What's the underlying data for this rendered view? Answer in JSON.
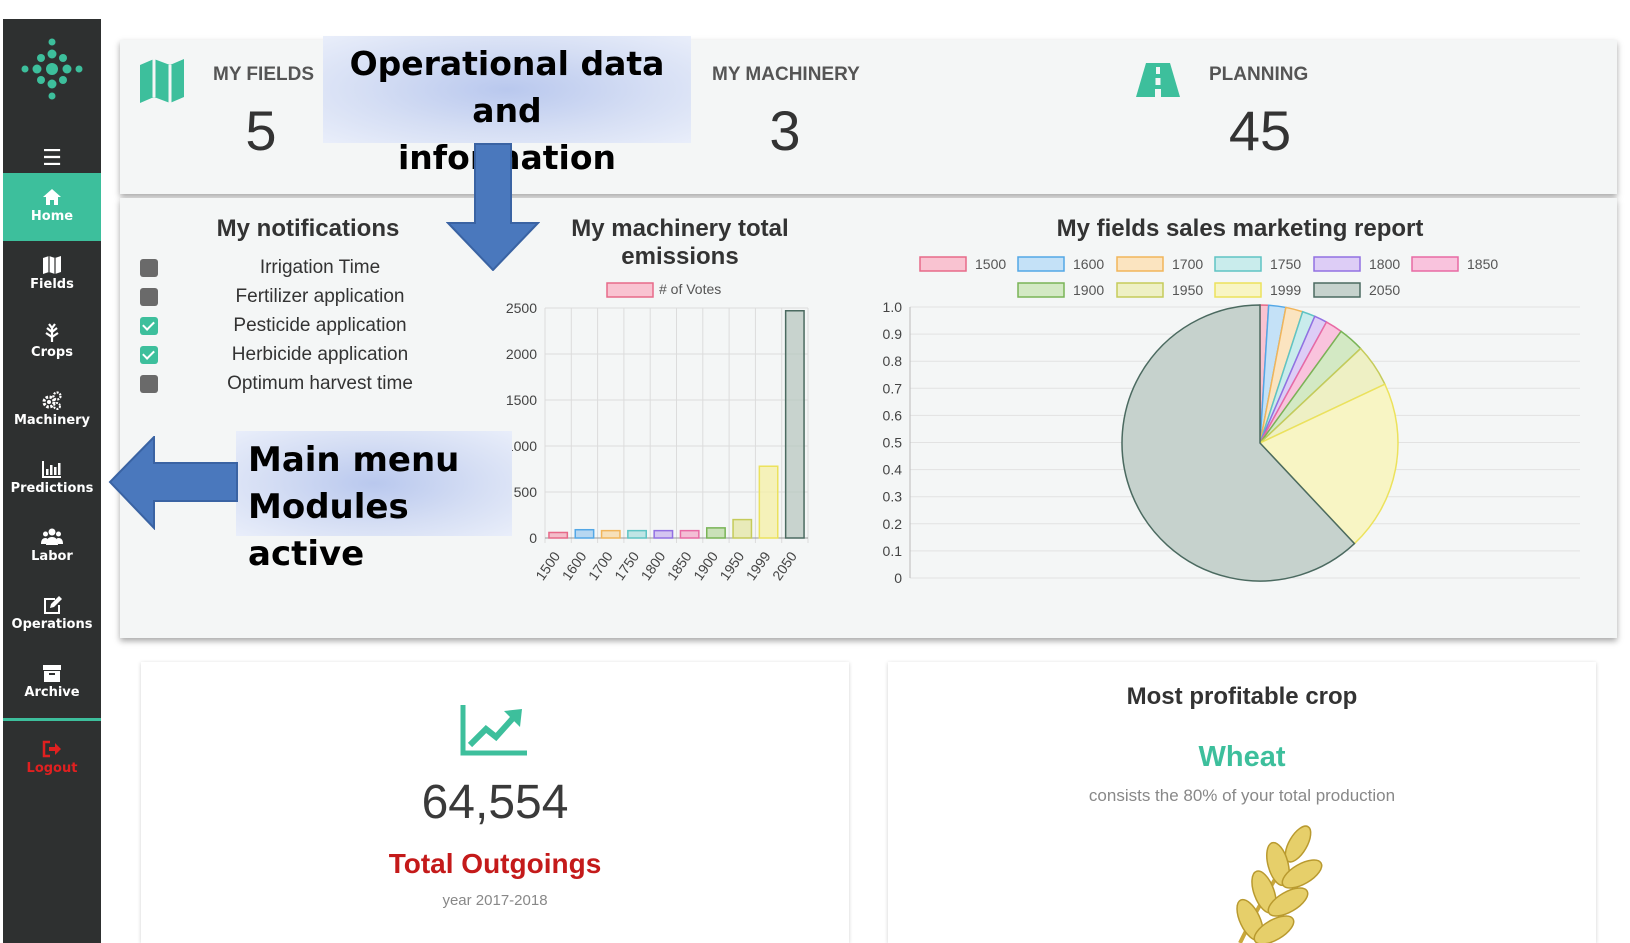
{
  "sidebar": {
    "menu_icon": "hamburger-icon",
    "items": [
      {
        "label": "Home",
        "icon": "home-icon",
        "active": true
      },
      {
        "label": "Fields",
        "icon": "map-icon"
      },
      {
        "label": "Crops",
        "icon": "plant-icon"
      },
      {
        "label": "Machinery",
        "icon": "cogs-icon"
      },
      {
        "label": "Predictions",
        "icon": "bar-chart-icon"
      },
      {
        "label": "Labor",
        "icon": "users-icon"
      },
      {
        "label": "Operations",
        "icon": "edit-icon"
      },
      {
        "label": "Archive",
        "icon": "archive-icon"
      }
    ],
    "logout": {
      "label": "Logout",
      "icon": "sign-out-icon"
    }
  },
  "stats": {
    "fields": {
      "label": "MY FIELDS",
      "value": "5",
      "icon": "map-icon"
    },
    "machinery": {
      "label": "MY MACHINERY",
      "value": "3"
    },
    "planning": {
      "label": "PLANNING",
      "value": "45",
      "icon": "road-icon"
    }
  },
  "callouts": {
    "top_line1": "Operational data and",
    "top_line2": "information",
    "left_line1": "Main menu",
    "left_line2": "Modules active"
  },
  "notifications": {
    "title": "My notifications",
    "items": [
      {
        "label": "Irrigation Time",
        "checked": false
      },
      {
        "label": "Fertilizer application",
        "checked": false
      },
      {
        "label": "Pesticide application",
        "checked": true
      },
      {
        "label": "Herbicide application",
        "checked": true
      },
      {
        "label": "Optimum harvest time",
        "checked": false
      }
    ]
  },
  "chart_data": [
    {
      "type": "bar",
      "title": "My machinery total emissions",
      "legend": [
        "# of Votes"
      ],
      "categories": [
        "1500",
        "1600",
        "1700",
        "1750",
        "1800",
        "1850",
        "1900",
        "1950",
        "1999",
        "2050"
      ],
      "values": [
        60,
        90,
        80,
        80,
        80,
        80,
        110,
        200,
        780,
        2470
      ],
      "ylim": [
        0,
        2500
      ],
      "yticks": [
        "0",
        "500",
        "1000",
        "1500",
        "2000",
        "2500"
      ],
      "grid": true,
      "legend_position": "top",
      "colors": [
        "#f2a6b8",
        "#9ccbef",
        "#f7d7a0",
        "#a8dede",
        "#c6b0ef",
        "#f2a6c8",
        "#b8d9a0",
        "#e3e6a0",
        "#f5f0a0",
        "#b5c4be"
      ],
      "borders": [
        "#e76a89",
        "#53a7e6",
        "#f1b55a",
        "#5fc4c4",
        "#9270e2",
        "#e86aa4",
        "#79b456",
        "#c5cb5a",
        "#ece25c",
        "#4b6a60"
      ]
    },
    {
      "type": "pie",
      "title": "My fields sales marketing report",
      "categories": [
        "1500",
        "1600",
        "1700",
        "1750",
        "1800",
        "1850",
        "1900",
        "1950",
        "1999",
        "2050"
      ],
      "values": [
        1,
        2,
        2,
        1.5,
        1.5,
        2,
        3,
        5,
        20,
        62
      ],
      "yticks": [
        "0",
        "0.1",
        "0.2",
        "0.3",
        "0.4",
        "0.5",
        "0.6",
        "0.7",
        "0.8",
        "0.9",
        "1.0"
      ],
      "grid": true,
      "legend_position": "top",
      "colors": [
        "#f9c3d1",
        "#c4e1f7",
        "#fbe4c0",
        "#c9ecec",
        "#ddcdf6",
        "#f9c3dd",
        "#d3e9c4",
        "#eef0c4",
        "#f8f5c4",
        "#c6d2cd"
      ],
      "borders": [
        "#e76a89",
        "#53a7e6",
        "#f1b55a",
        "#5fc4c4",
        "#9270e2",
        "#e86aa4",
        "#79b456",
        "#c5cb5a",
        "#ece25c",
        "#4b6a60"
      ]
    }
  ],
  "outgoings": {
    "value": "64,554",
    "label": "Total Outgoings",
    "sub": "year 2017-2018",
    "icon": "trend-up-icon"
  },
  "crop": {
    "title": "Most profitable crop",
    "name": "Wheat",
    "sub": "consists the 80% of your total production",
    "icon": "wheat-icon"
  },
  "colors": {
    "accent": "#3dbf9c",
    "sidebar_bg": "#2e3030",
    "danger": "#c41a1a",
    "callout_arrow": "#4a78bd"
  }
}
